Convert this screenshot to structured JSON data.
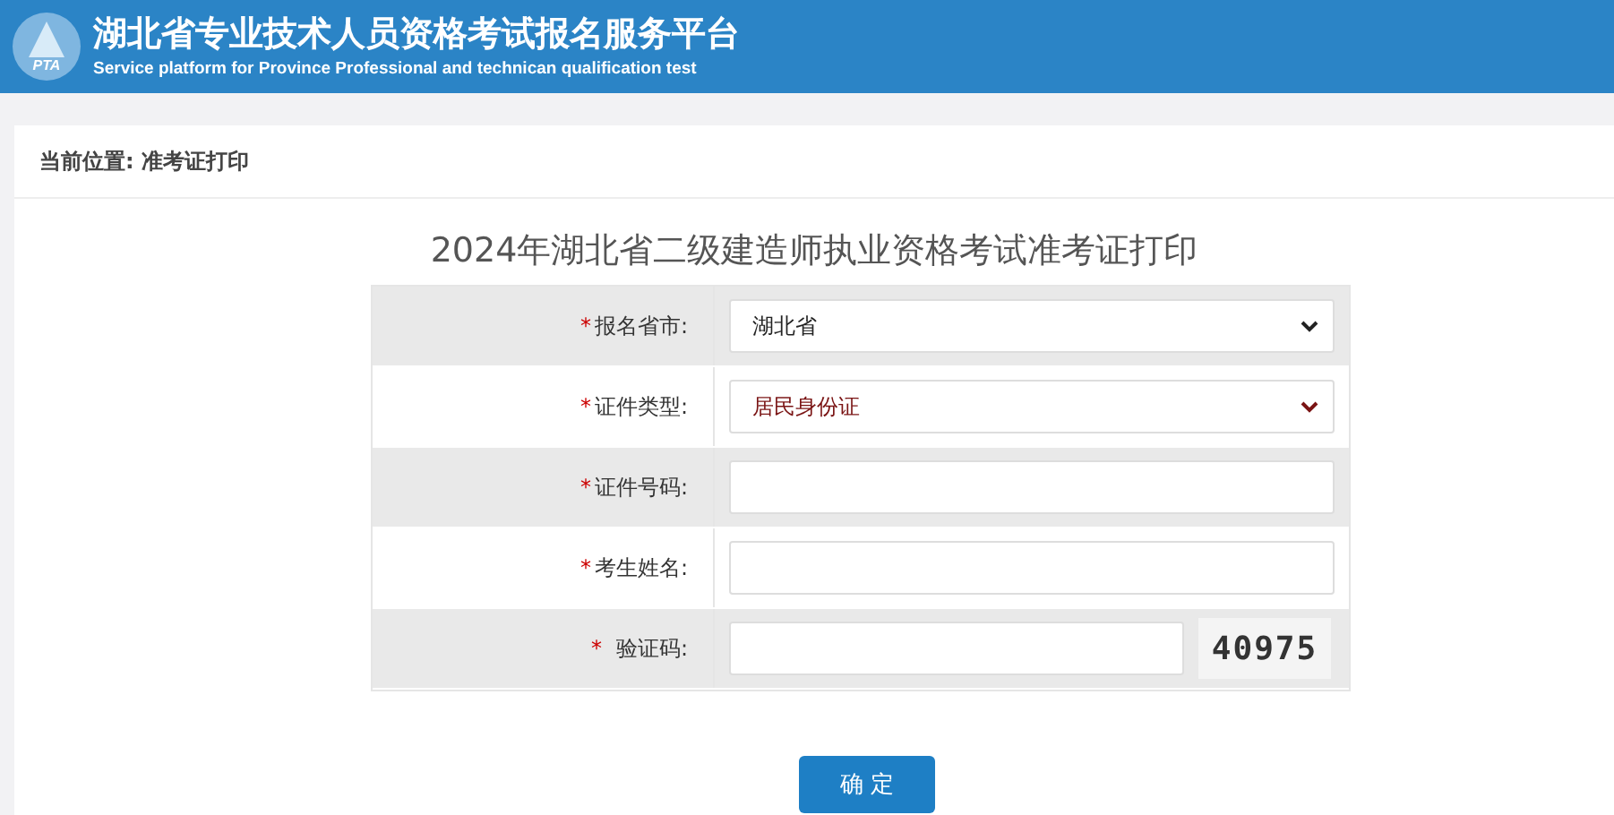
{
  "header": {
    "title": "湖北省专业技术人员资格考试报名服务平台",
    "subtitle": "Service platform for Province Professional and technican qualification test",
    "logo_text": "PTA"
  },
  "breadcrumb": {
    "label": "当前位置:",
    "current": "准考证打印"
  },
  "form": {
    "title": "2024年湖北省二级建造师执业资格考试准考证打印",
    "fields": [
      {
        "kind": "select",
        "label": "报名省市:",
        "required": true,
        "value": "湖北省",
        "emphasized": false
      },
      {
        "kind": "select",
        "label": "证件类型:",
        "required": true,
        "value": "居民身份证",
        "emphasized": true
      },
      {
        "kind": "input",
        "label": "证件号码:",
        "required": true
      },
      {
        "kind": "input",
        "label": "考生姓名:",
        "required": true
      },
      {
        "kind": "captcha",
        "label": "验证码:",
        "required": true,
        "captcha": "40975"
      }
    ],
    "required_mark": "*",
    "submit": "确 定"
  }
}
